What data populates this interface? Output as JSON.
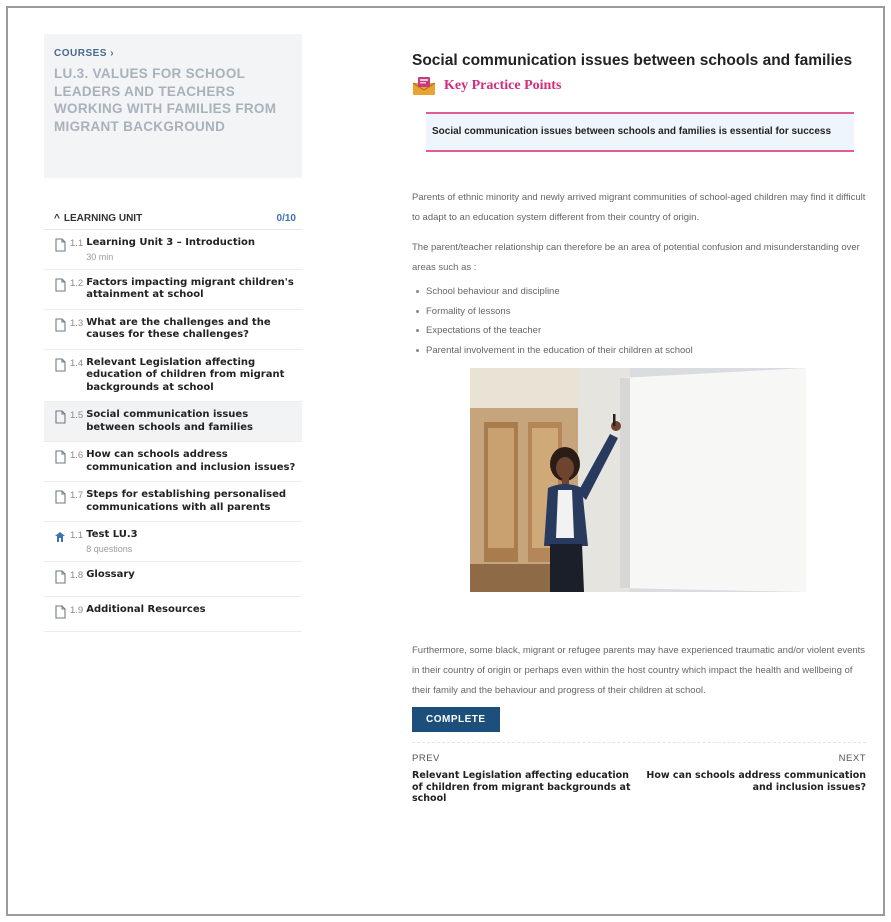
{
  "sidebar": {
    "breadcrumb": "COURSES",
    "course_title": "LU.3. VALUES FOR SCHOOL LEADERS AND TEACHERS WORKING WITH FAMILIES FROM MIGRANT BACKGROUND",
    "unit_label": "LEARNING UNIT",
    "unit_progress": "0/10",
    "lessons": [
      {
        "num": "1.1",
        "title": "Learning Unit 3 – Introduction",
        "meta": "30 min",
        "icon": "document-icon",
        "active": false
      },
      {
        "num": "1.2",
        "title": "Factors impacting migrant children's attainment at school",
        "meta": "",
        "icon": "document-icon",
        "active": false
      },
      {
        "num": "1.3",
        "title": "What are the challenges and the causes for these challenges?",
        "meta": "",
        "icon": "document-icon",
        "active": false
      },
      {
        "num": "1.4",
        "title": "Relevant Legislation affecting education of children from migrant backgrounds at school",
        "meta": "",
        "icon": "document-icon",
        "active": false
      },
      {
        "num": "1.5",
        "title": "Social communication issues between schools and families",
        "meta": "",
        "icon": "document-icon",
        "active": true
      },
      {
        "num": "1.6",
        "title": "How can schools address communication and inclusion issues?",
        "meta": "",
        "icon": "document-icon",
        "active": false
      },
      {
        "num": "1.7",
        "title": "Steps for establishing personalised communications with all parents",
        "meta": "",
        "icon": "document-icon",
        "active": false
      },
      {
        "num": "1.1",
        "title": "Test LU.3",
        "meta": "8 questions",
        "icon": "quiz-icon",
        "active": false
      },
      {
        "num": "1.8",
        "title": "Glossary",
        "meta": "",
        "icon": "document-icon",
        "active": false
      },
      {
        "num": "1.9",
        "title": "Additional Resources",
        "meta": "",
        "icon": "document-icon",
        "active": false
      }
    ]
  },
  "main": {
    "title": "Social communication issues between schools and families",
    "kpp_label": "Key Practice Points",
    "callout": "Social communication issues between schools and families is essential for success",
    "para1": "Parents of ethnic minority and newly arrived migrant communities of school-aged children may find it difficult to adapt to an education system different from their country of origin.",
    "para2": "The parent/teacher relationship can therefore be an area of potential confusion and misunderstanding over areas such as :",
    "bullets": [
      "School behaviour and discipline",
      "Formality of lessons",
      "Expectations of the teacher",
      "Parental involvement in the education of their children at school"
    ],
    "para3": "Furthermore, some black, migrant or refugee parents may have experienced traumatic and/or violent events in their country of origin or perhaps even within the host country which impact the health and wellbeing of their family and the behaviour and progress of their children at school.",
    "complete_label": "COMPLETE",
    "prev_label": "PREV",
    "prev_title": "Relevant Legislation affecting education of children from migrant backgrounds at school",
    "next_label": "NEXT",
    "next_title": "How can schools address communication and inclusion issues?"
  },
  "colors": {
    "accent_blue": "#1c4f7c",
    "kpp_pink": "#d22c7a",
    "callout_border": "#e05c94",
    "callout_bg": "#eef6fc"
  }
}
